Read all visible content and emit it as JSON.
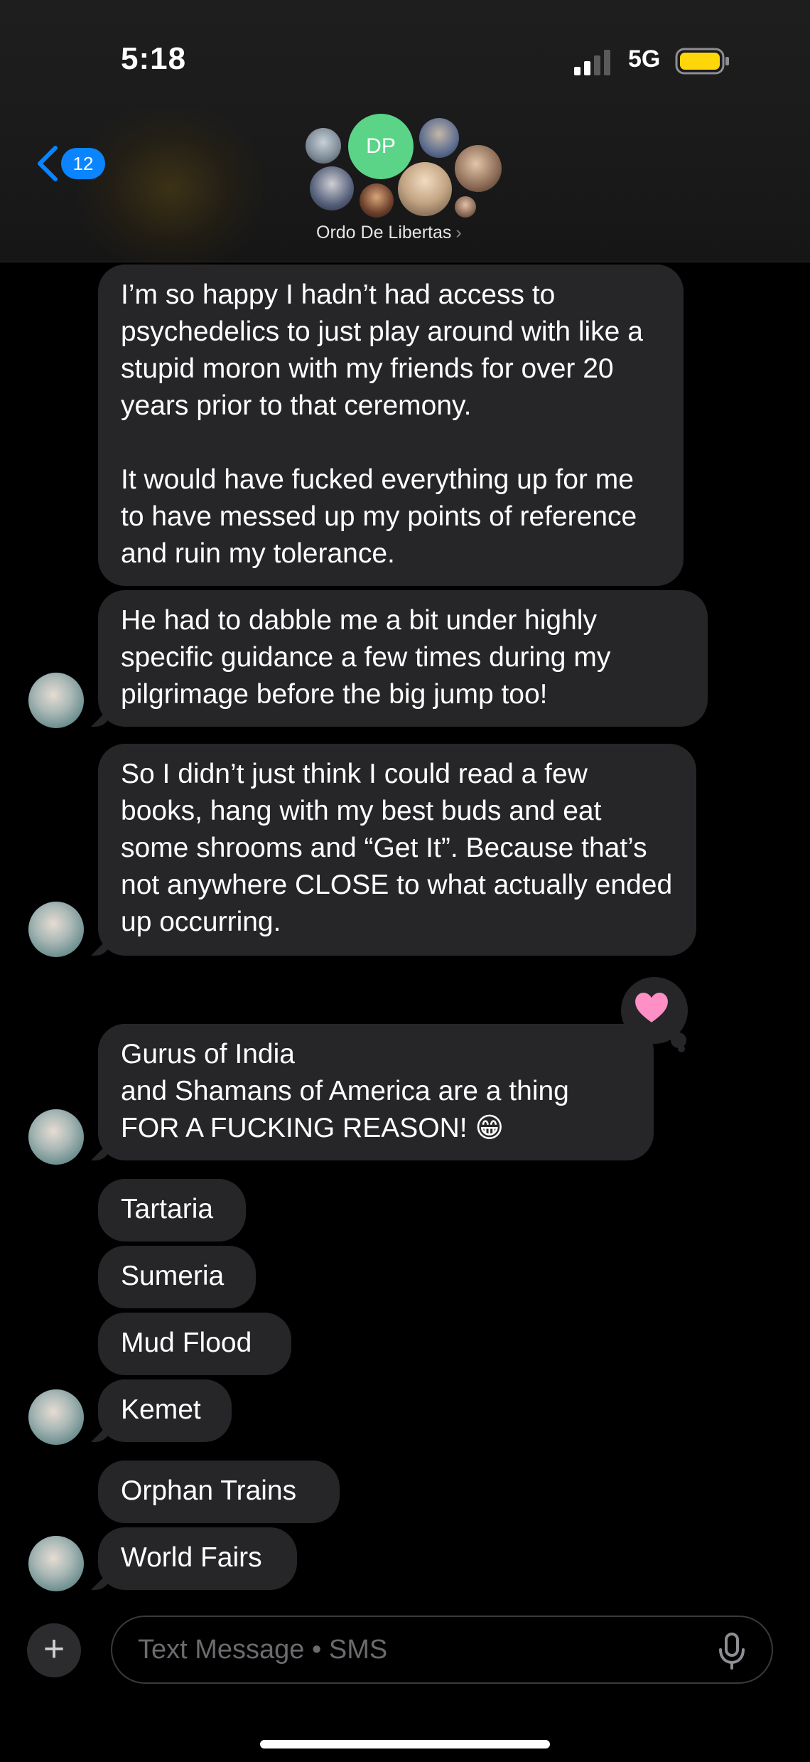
{
  "status_bar": {
    "time": "5:18",
    "network": "5G"
  },
  "header": {
    "back_badge": "12",
    "group_initials": "DP",
    "group_name": "Ordo De Libertas",
    "group_chevron": "›"
  },
  "messages": [
    {
      "text": "I’m so happy I hadn’t had access to psychedelics to just play around with like a stupid moron with my friends for over 20 years prior to that ceremony.\n\nIt would have fucked everything up for me to have messed up my points of reference and ruin my tolerance."
    },
    {
      "text": "He had to dabble me a bit under highly specific guidance a few times during my pilgrimage before the big jump too!"
    },
    {
      "text": "So I didn’t just think I could read a few books, hang with my best buds and eat some shrooms and “Get It”. Because that’s not anywhere CLOSE to what actually ended up occurring."
    },
    {
      "text": "Gurus of India\nand Shamans of America are a thing\nFOR A FUCKING REASON! 😁",
      "reaction": "heart"
    },
    {
      "text": "Tartaria"
    },
    {
      "text": "Sumeria"
    },
    {
      "text": "Mud Flood"
    },
    {
      "text": "Kemet"
    },
    {
      "text": "Orphan Trains"
    },
    {
      "text": "World Fairs"
    }
  ],
  "composer": {
    "placeholder": "Text Message • SMS",
    "plus": "+"
  },
  "colors": {
    "bubble": "#262628",
    "accent": "#0a84ff",
    "dp_avatar": "#5bd488",
    "battery": "#ffd60a",
    "heart": "#ff8fc4"
  }
}
